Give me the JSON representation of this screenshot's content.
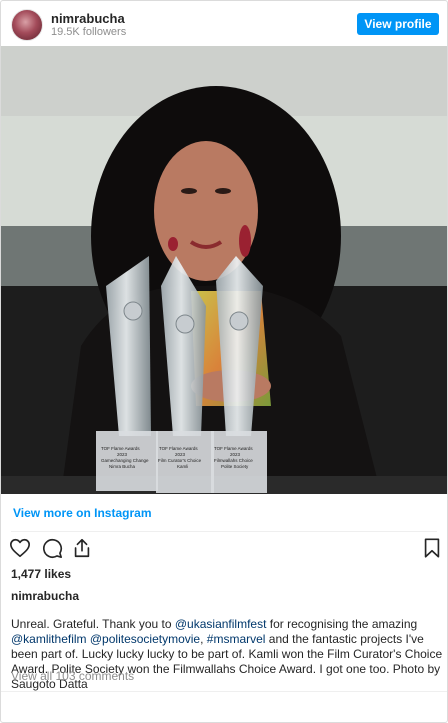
{
  "header": {
    "username": "nimrabucha",
    "followers": "19.5K followers",
    "view_profile_label": "View profile"
  },
  "photo": {
    "trophy_labels": [
      {
        "line1": "TOF Flame Awards",
        "line2": "2023",
        "line3": "Gamechanging Change",
        "line4": "Nimra Bucha"
      },
      {
        "line1": "TOF Flame Awards",
        "line2": "2023",
        "line3": "Film Curator's Choice",
        "line4": "Kamli"
      },
      {
        "line1": "TOF Flame Awards",
        "line2": "2023",
        "line3": "Filmwallahs Choice",
        "line4": "Polite Society"
      }
    ]
  },
  "view_more_label": "View more on Instagram",
  "icons": {
    "like": "heart-icon",
    "comment": "comment-icon",
    "share": "share-icon",
    "save": "bookmark-icon"
  },
  "likes": "1,477 likes",
  "poster": "nimrabucha",
  "caption": {
    "part1": "Unreal. Grateful. Thank you to ",
    "tag1": "@ukasianfilmfest",
    "part2": " for recognising the amazing ",
    "tag2": "@kamlithefilm",
    "part3": " ",
    "tag3": "@politesocietymovie",
    "part4": ", ",
    "tag4": "#msmarvel",
    "part5": " and the fantastic projects I've been part of. Lucky lucky lucky to be part of. Kamli won the Film Curator's Choice Award. Polite Society won the Filmwallahs Choice Award. I got one too. Photo by Saugoto Datta"
  },
  "comments_label": "View all 103 comments",
  "colors": {
    "accent": "#0095f6",
    "tag": "#00376b",
    "muted": "#8e8e8e"
  }
}
